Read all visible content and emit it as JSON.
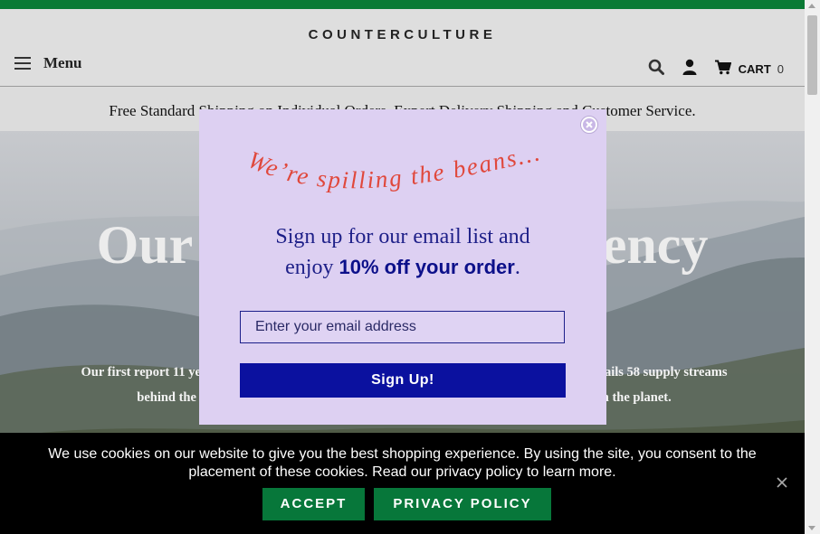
{
  "header": {
    "logo": "COUNTERCULTURE",
    "menu_label": "Menu",
    "cart_label": "CART",
    "cart_count": "0",
    "icons": [
      "hamburger-icon",
      "search-icon",
      "account-icon",
      "cart-icon"
    ]
  },
  "announcement": "Free Standard Shipping on Individual Orders, Expert Delivery Shipping and Customer Service.",
  "hero": {
    "title": "Our Annual Transparency",
    "body": "Our first report 11 years ago detailed our commitment to transparency. This year’s report details 58 supply streams behind the coffees we sell, the full cost of our sourcing operations, and our impact on the planet."
  },
  "popup": {
    "tagline": "We’re spilling the beans...",
    "line1": "Sign up for our email list and",
    "line2_prefix": "enjoy ",
    "line2_bold": "10% off your order",
    "line2_suffix": ".",
    "email_placeholder": "Enter your email address",
    "signup_button": "Sign Up!",
    "colors": {
      "background": "#ddd0f2",
      "tagline": "#e0483c",
      "text": "#1d1f88",
      "button": "#0b119f"
    }
  },
  "cookie_banner": {
    "text": "We use cookies on our website to give you the best shopping experience. By using the site, you consent to the placement of these cookies. Read our privacy policy to learn more.",
    "accept": "ACCEPT",
    "privacy": "PRIVACY POLICY",
    "colors": {
      "background": "#000000",
      "button": "#07773a"
    }
  },
  "colors": {
    "accent_green": "#0a7a35"
  }
}
